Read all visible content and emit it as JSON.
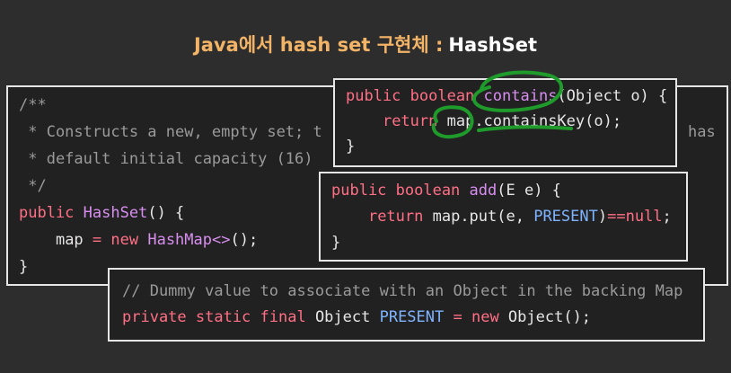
{
  "title": {
    "orange_part": "Java에서 hash set 구현체 :",
    "white_part": "HashSet"
  },
  "colors": {
    "background": "#2d2d2d",
    "panel_bg": "#222121",
    "keyword": "#ff6f85",
    "method": "#d88ef0",
    "comment": "#9a9a9a",
    "constant": "#7fb4ff",
    "annotation": "#1f9b2c",
    "title_accent": "#f3b468"
  },
  "constructor_panel": {
    "comment_line1": "/**",
    "comment_line2": " * Constructs a new, empty set; t",
    "comment_line2_right": "has",
    "comment_line3": " * default initial capacity (16)",
    "comment_line4": " */",
    "kw_public": "public",
    "class_name": "HashSet",
    "ctor_tail": "() {",
    "indent": "    ",
    "field_map": "map",
    "assign": " = ",
    "kw_new": "new",
    "hashmap": " HashMap<>",
    "stmt_end": "();",
    "close_brace": "}"
  },
  "contains_panel": {
    "kw": "public boolean",
    "method": "contains",
    "params": "(Object o) {",
    "indent": "    ",
    "kw_return": "return",
    "body": " map.containsKey(o);",
    "close_brace": "}"
  },
  "add_panel": {
    "kw": "public boolean",
    "method": "add",
    "params": "(E e) {",
    "indent": "    ",
    "kw_return": "return",
    "body_prefix": " map.put(e, ",
    "constant": "PRESENT",
    "body_mid": ")",
    "op": "==",
    "null_kw": "null",
    "body_end": ";",
    "close_brace": "}"
  },
  "present_panel": {
    "comment": "// Dummy value to associate with an Object in the backing Map",
    "kw": "private static final",
    "type": " Object ",
    "constant": "PRESENT",
    "op": " = ",
    "kw_new": "new",
    "tail": " Object();"
  },
  "annotation_icon": "green-handwritten-circle"
}
